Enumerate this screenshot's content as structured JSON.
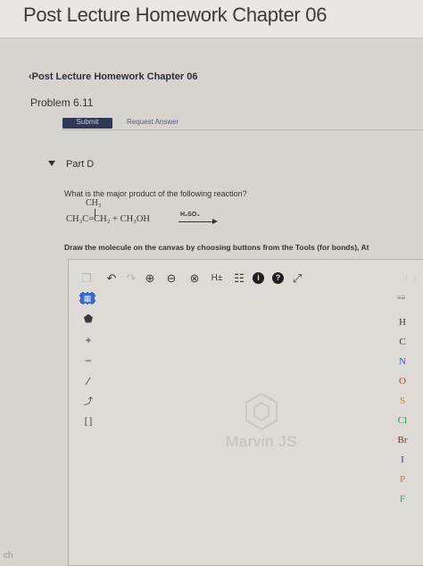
{
  "header": {
    "title": "Post Lecture Homework Chapter 06"
  },
  "breadcrumb": {
    "label": "‹Post Lecture Homework Chapter 06"
  },
  "problem": {
    "label": "Problem 6.11"
  },
  "actions": {
    "submit_label": "Submit",
    "request_label": "Request Answer"
  },
  "part": {
    "label": "Part D"
  },
  "question": {
    "text": "What is the major product of the following reaction?",
    "reaction": {
      "substituent": "CH₃",
      "reactant": "CH₃C=CH₂  +  CH₃OH",
      "reagent": "H₂SO₄"
    }
  },
  "instructions": "Draw the molecule on the canvas by choosing buttons from the Tools (for bonds), At",
  "toolbar": {
    "items": [
      {
        "icon": "copy-icon",
        "glyph": "❐"
      },
      {
        "icon": "undo-icon",
        "glyph": "↶"
      },
      {
        "icon": "redo-icon",
        "glyph": "↷"
      },
      {
        "icon": "zoom-in-icon",
        "glyph": "⊕"
      },
      {
        "icon": "zoom-out-icon",
        "glyph": "⊖"
      },
      {
        "icon": "zoom-fit-icon",
        "glyph": "⊗"
      },
      {
        "icon": "hydrogen-toggle-icon",
        "glyph": "H±"
      },
      {
        "icon": "template-icon",
        "glyph": "☷"
      },
      {
        "icon": "info-icon",
        "glyph": "i"
      },
      {
        "icon": "help-icon",
        "glyph": "?"
      },
      {
        "icon": "expand-icon",
        "glyph": "⤢"
      }
    ]
  },
  "left_tools": {
    "select": "▦",
    "eraser": "⬟",
    "plus": "+",
    "minus": "–",
    "bond": "∕",
    "chain": "⤴",
    "bracket": "[ ]"
  },
  "canvas": {
    "logo_text": "Marvin JS"
  },
  "periodic": {
    "label": "≡≡",
    "atoms": [
      "H",
      "C",
      "N",
      "O",
      "S",
      "Cl",
      "Br",
      "I",
      "P",
      "F"
    ]
  },
  "footer": {
    "left_text": "ch"
  }
}
